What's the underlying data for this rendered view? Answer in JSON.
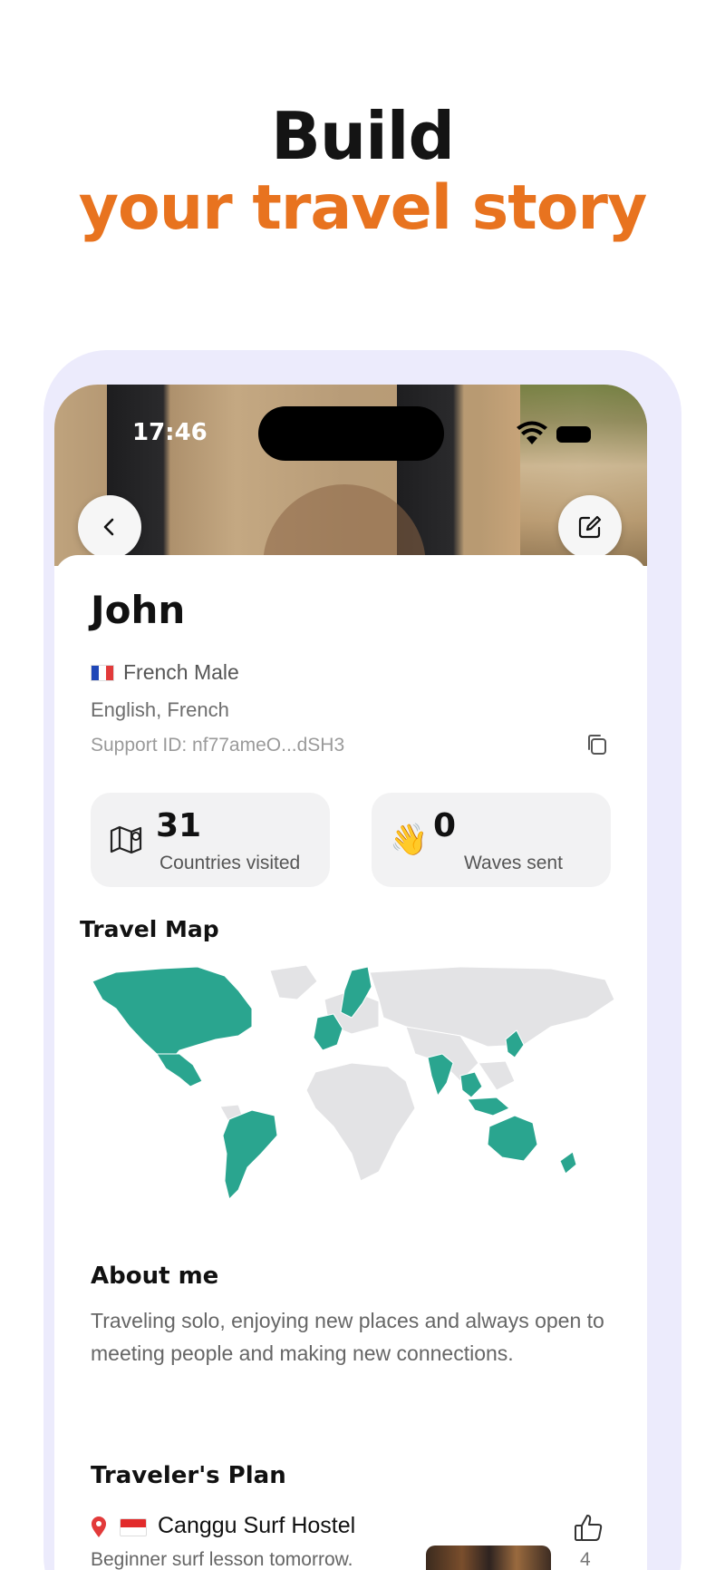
{
  "headline": {
    "line1": "Build",
    "line2": "your travel story"
  },
  "status_bar": {
    "time": "17:46"
  },
  "profile": {
    "name": "John",
    "nationality_gender": "French Male",
    "languages": "English, French",
    "support_id": "Support ID: nf77ameO...dSH3"
  },
  "stats": [
    {
      "value": "31",
      "label": "Countries visited",
      "icon": "map-icon"
    },
    {
      "value": "0",
      "label": "Waves sent",
      "icon": "waving-hand-icon"
    }
  ],
  "travel_map": {
    "title": "Travel Map",
    "visited_color": "#2aa58f",
    "unvisited_color": "#e3e3e5"
  },
  "about": {
    "title": "About me",
    "text": "Traveling solo, enjoying new places and always open to meeting people and making new connections."
  },
  "plan": {
    "title": "Traveler's Plan",
    "place": "Canggu Surf Hostel",
    "description": "Beginner surf lesson tomorrow.",
    "likes": "4"
  },
  "colors": {
    "accent_orange": "#e8731f",
    "frame_lavender": "#ecebfc",
    "pin_red": "#e23a3a"
  }
}
